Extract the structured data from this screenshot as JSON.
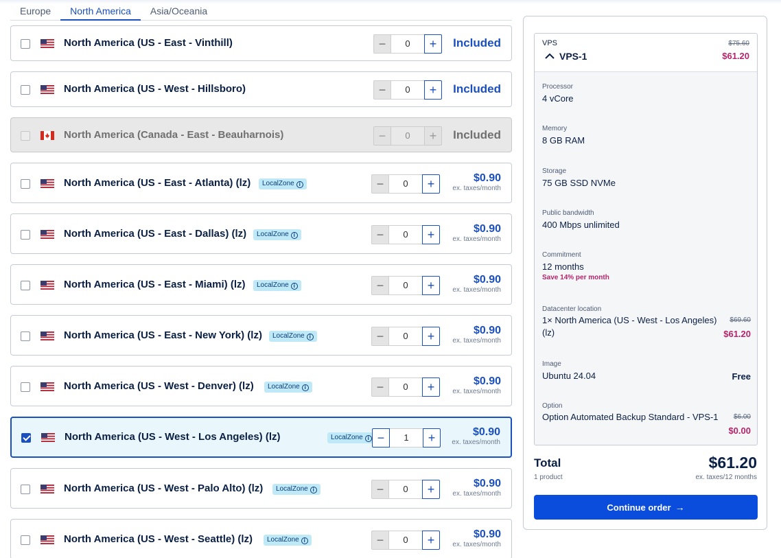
{
  "tabs": [
    {
      "label": "Europe"
    },
    {
      "label": "North America"
    },
    {
      "label": "Asia/Oceania"
    }
  ],
  "locations": [
    {
      "name": "North America (US - East - Vinthill)",
      "flag": "us",
      "qty": "0",
      "price_text": "Included"
    },
    {
      "name": "North America (US - West - Hillsboro)",
      "flag": "us",
      "qty": "0",
      "price_text": "Included"
    },
    {
      "name": "North America (Canada - East - Beauharnois)",
      "flag": "ca",
      "qty": "0",
      "price_text": "Included",
      "disabled": true
    },
    {
      "name": "North America (US - East - Atlanta) (lz)",
      "flag": "us",
      "qty": "0",
      "badge": "LocalZone",
      "price": "$0.90",
      "price_sub": "ex. taxes/month"
    },
    {
      "name": "North America (US - East - Dallas) (lz)",
      "flag": "us",
      "qty": "0",
      "badge": "LocalZone",
      "price": "$0.90",
      "price_sub": "ex. taxes/month"
    },
    {
      "name": "North America (US - East - Miami) (lz)",
      "flag": "us",
      "qty": "0",
      "badge": "LocalZone",
      "price": "$0.90",
      "price_sub": "ex. taxes/month"
    },
    {
      "name": "North America (US - East - New York) (lz)",
      "flag": "us",
      "qty": "0",
      "badge": "LocalZone",
      "price": "$0.90",
      "price_sub": "ex. taxes/month"
    },
    {
      "name": "North America (US - West - Denver) (lz)",
      "flag": "us",
      "qty": "0",
      "badge": "LocalZone",
      "price": "$0.90",
      "price_sub": "ex. taxes/month"
    },
    {
      "name": "North America (US - West - Los Angeles) (lz)",
      "flag": "us",
      "qty": "1",
      "badge": "LocalZone",
      "price": "$0.90",
      "price_sub": "ex. taxes/month",
      "selected": true
    },
    {
      "name": "North America (US - West - Palo Alto) (lz)",
      "flag": "us",
      "qty": "0",
      "badge": "LocalZone",
      "price": "$0.90",
      "price_sub": "ex. taxes/month"
    },
    {
      "name": "North America (US - West - Seattle) (lz)",
      "flag": "us",
      "qty": "0",
      "badge": "LocalZone",
      "price": "$0.90",
      "price_sub": "ex. taxes/month"
    }
  ],
  "summary": {
    "category": "VPS",
    "product": "VPS-1",
    "old_price": "$75.60",
    "new_price": "$61.20",
    "processor": {
      "label": "Processor",
      "value": "4 vCore"
    },
    "memory": {
      "label": "Memory",
      "value": "8 GB RAM"
    },
    "storage": {
      "label": "Storage",
      "value": "75 GB SSD NVMe"
    },
    "bandwidth": {
      "label": "Public bandwidth",
      "value": "400 Mbps unlimited"
    },
    "commitment": {
      "label": "Commitment",
      "value": "12 months",
      "save": "Save 14% per month"
    },
    "datacenter": {
      "label": "Datacenter location",
      "value": "1× North America (US - West - Los Angeles) (lz)",
      "old_price": "$69.60",
      "new_price": "$61.20"
    },
    "image": {
      "label": "Image",
      "value": "Ubuntu 24.04",
      "price": "Free"
    },
    "option": {
      "label": "Option",
      "value": "Option Automated Backup Standard - VPS-1",
      "old_price": "$6.00",
      "new_price": "$0.00"
    },
    "total_label": "Total",
    "total_sub": "1 product",
    "total_price": "$61.20",
    "total_taxes": "ex. taxes/12 months",
    "continue_label": "Continue order"
  },
  "colors": {
    "accent": "#1a4fc0",
    "button": "#0a4cdb",
    "discount": "#b4246a",
    "badge": "#bfe9f6"
  }
}
